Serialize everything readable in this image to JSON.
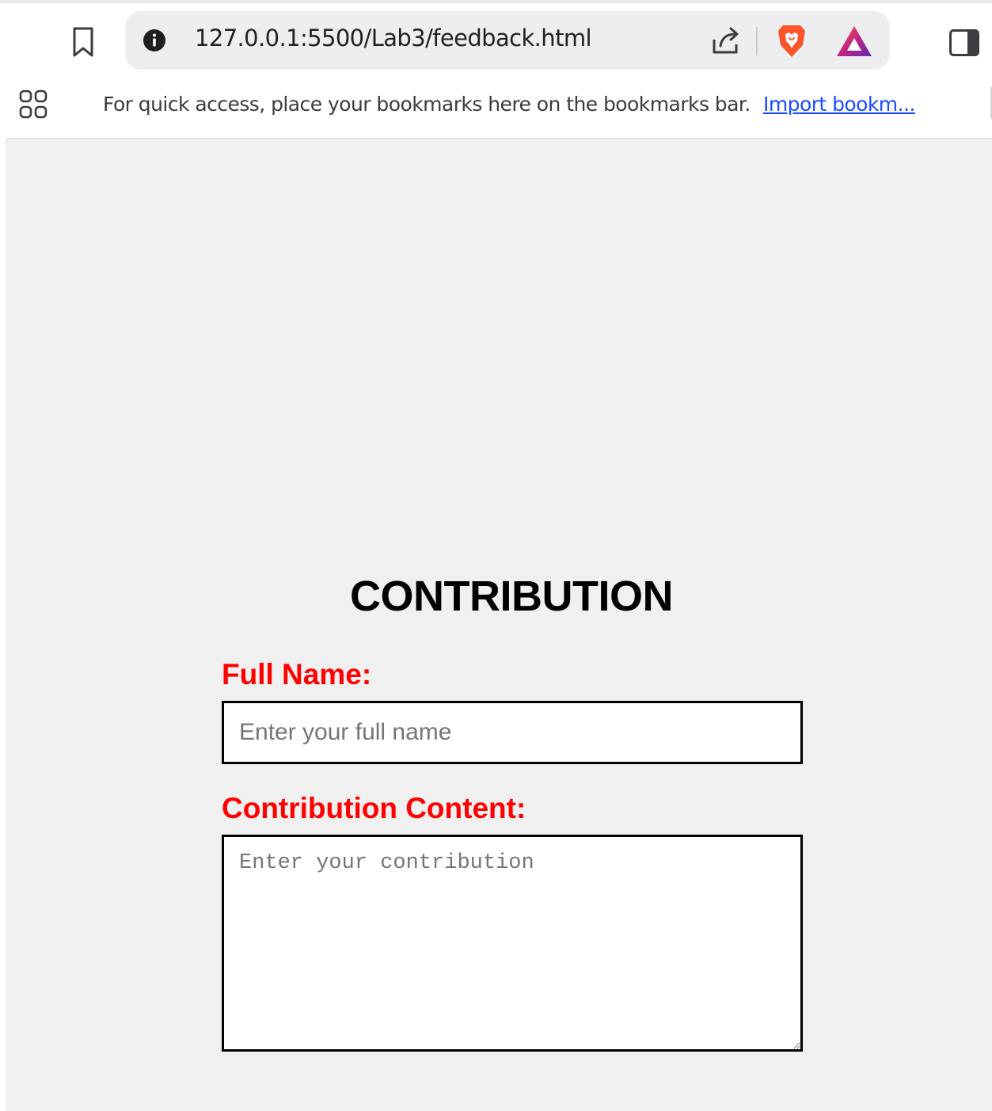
{
  "browser": {
    "url": "127.0.0.1:5500/Lab3/feedback.html",
    "icons": {
      "bookmark": "bookmark-icon",
      "site_info": "info-icon",
      "share": "share-icon",
      "shields": "brave-shields-icon",
      "rewards": "brave-rewards-icon",
      "sidebar": "sidebar-toggle-icon",
      "apps": "apps-grid-icon"
    },
    "bookmarks_bar": {
      "hint": "For quick access, place your bookmarks here on the bookmarks bar.",
      "import_link": "Import bookm..."
    }
  },
  "page": {
    "title": "CONTRIBUTION",
    "full_name": {
      "label": "Full Name:",
      "placeholder": "Enter your full name",
      "value": ""
    },
    "contribution": {
      "label": "Contribution Content:",
      "placeholder": "Enter your contribution",
      "value": ""
    }
  },
  "colors": {
    "label": "#ff0000",
    "page_background": "#f0f0f0",
    "field_border": "#000000",
    "link": "#1a4bff",
    "shields_orange": "#fb542b",
    "rewards_purple": "#6b2bb0"
  }
}
